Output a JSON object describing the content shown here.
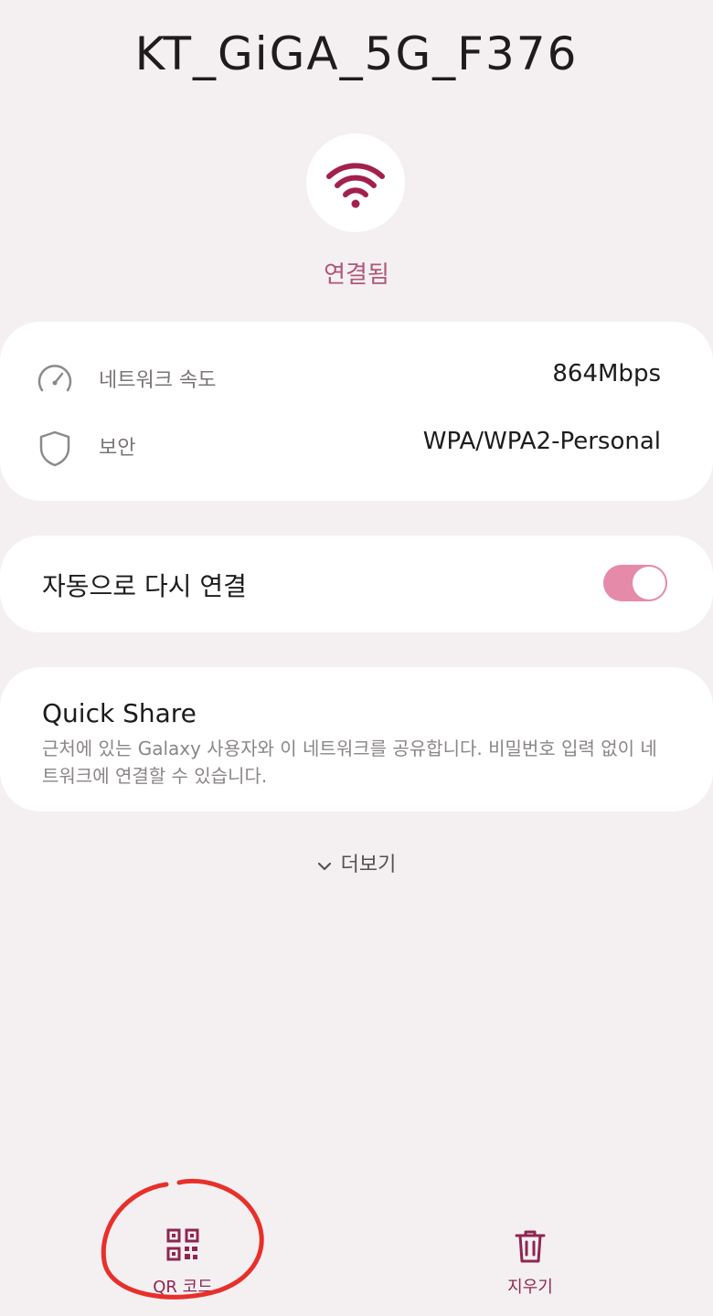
{
  "network": {
    "ssid": "KT_GiGA_5G_F376",
    "status": "연결됨"
  },
  "info": {
    "speed_label": "네트워크 속도",
    "speed_value": "864Mbps",
    "security_label": "보안",
    "security_value": "WPA/WPA2-Personal"
  },
  "auto_reconnect": {
    "label": "자동으로 다시 연결",
    "enabled": true
  },
  "quick_share": {
    "title": "Quick Share",
    "description": "근처에 있는 Galaxy 사용자와 이 네트워크를 공유합니다. 비밀번호 입력 없이 네트워크에 연결할 수 있습니다."
  },
  "more": {
    "label": "더보기"
  },
  "actions": {
    "qr_label": "QR 코드",
    "delete_label": "지우기"
  },
  "icons": {
    "wifi": "wifi-icon",
    "speed": "speedometer-icon",
    "security": "shield-icon",
    "more": "chevron-down-icon",
    "qr": "qr-code-icon",
    "delete": "trash-icon"
  },
  "colors": {
    "accent": "#b0567a",
    "toggle_on": "#e58aa8",
    "action": "#8e2650",
    "background": "#f4f0f2",
    "annotation": "#e8302a"
  }
}
